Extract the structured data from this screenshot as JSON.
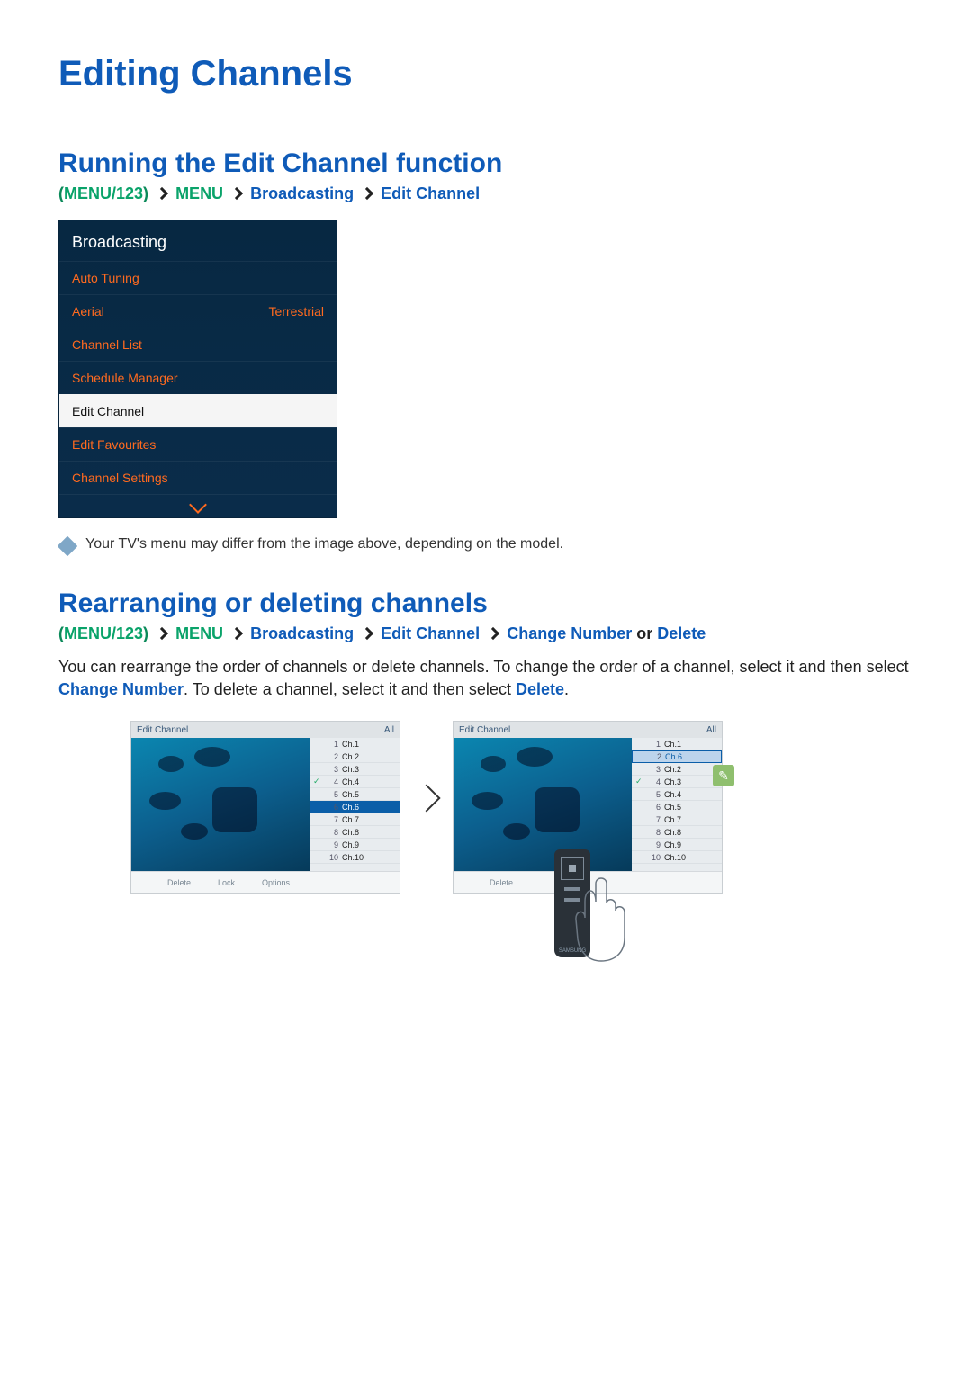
{
  "h1": "Editing Channels",
  "sec1": {
    "title": "Running the Edit Channel function",
    "path": {
      "p0a": "(",
      "p0b": "MENU/123",
      "p0c": ")",
      "p1": "MENU",
      "p2": "Broadcasting",
      "p3": "Edit Channel"
    },
    "menu": {
      "header": "Broadcasting",
      "items": [
        {
          "label": "Auto Tuning",
          "value": ""
        },
        {
          "label": "Aerial",
          "value": "Terrestrial"
        },
        {
          "label": "Channel List",
          "value": ""
        },
        {
          "label": "Schedule Manager",
          "value": ""
        },
        {
          "label": "Edit Channel",
          "value": ""
        },
        {
          "label": "Edit Favourites",
          "value": ""
        },
        {
          "label": "Channel Settings",
          "value": ""
        }
      ]
    },
    "note": "Your TV's menu may differ from the image above, depending on the model."
  },
  "sec2": {
    "title": "Rearranging or deleting channels",
    "path": {
      "p0a": "(",
      "p0b": "MENU/123",
      "p0c": ")",
      "p1": "MENU",
      "p2": "Broadcasting",
      "p3": "Edit Channel",
      "p4": "Change Number",
      "or": " or ",
      "p5": "Delete"
    },
    "body_a": "You can rearrange the order of channels or delete channels. To change the order of a channel, select it and then select ",
    "inline_change": "Change Number",
    "body_b": ". To delete a channel, select it and then select ",
    "inline_delete": "Delete",
    "body_c": "."
  },
  "shotA": {
    "title": "Edit Channel",
    "filter": "All",
    "channels": [
      {
        "n": "1",
        "name": "Ch.1"
      },
      {
        "n": "2",
        "name": "Ch.2"
      },
      {
        "n": "3",
        "name": "Ch.3"
      },
      {
        "n": "4",
        "name": "Ch.4",
        "check": "✓"
      },
      {
        "n": "5",
        "name": "Ch.5"
      },
      {
        "n": "6",
        "name": "Ch.6"
      },
      {
        "n": "7",
        "name": "Ch.7"
      },
      {
        "n": "8",
        "name": "Ch.8"
      },
      {
        "n": "9",
        "name": "Ch.9"
      },
      {
        "n": "10",
        "name": "Ch.10"
      }
    ],
    "highlight_index": 5,
    "foot1": "Delete",
    "foot2": "Lock",
    "foot3": "Options"
  },
  "shotB": {
    "title": "Edit Channel",
    "filter": "All",
    "channels": [
      {
        "n": "1",
        "name": "Ch.1"
      },
      {
        "n": "2",
        "name": "Ch.6"
      },
      {
        "n": "3",
        "name": "Ch.2"
      },
      {
        "n": "4",
        "name": "Ch.3",
        "check": "✓"
      },
      {
        "n": "5",
        "name": "Ch.4"
      },
      {
        "n": "6",
        "name": "Ch.5"
      },
      {
        "n": "7",
        "name": "Ch.7"
      },
      {
        "n": "8",
        "name": "Ch.8"
      },
      {
        "n": "9",
        "name": "Ch.9"
      },
      {
        "n": "10",
        "name": "Ch.10"
      }
    ],
    "move_index": 1,
    "foot1": "Delete",
    "remote_label": "SAMSUNG"
  },
  "lock_glyph": "✎"
}
